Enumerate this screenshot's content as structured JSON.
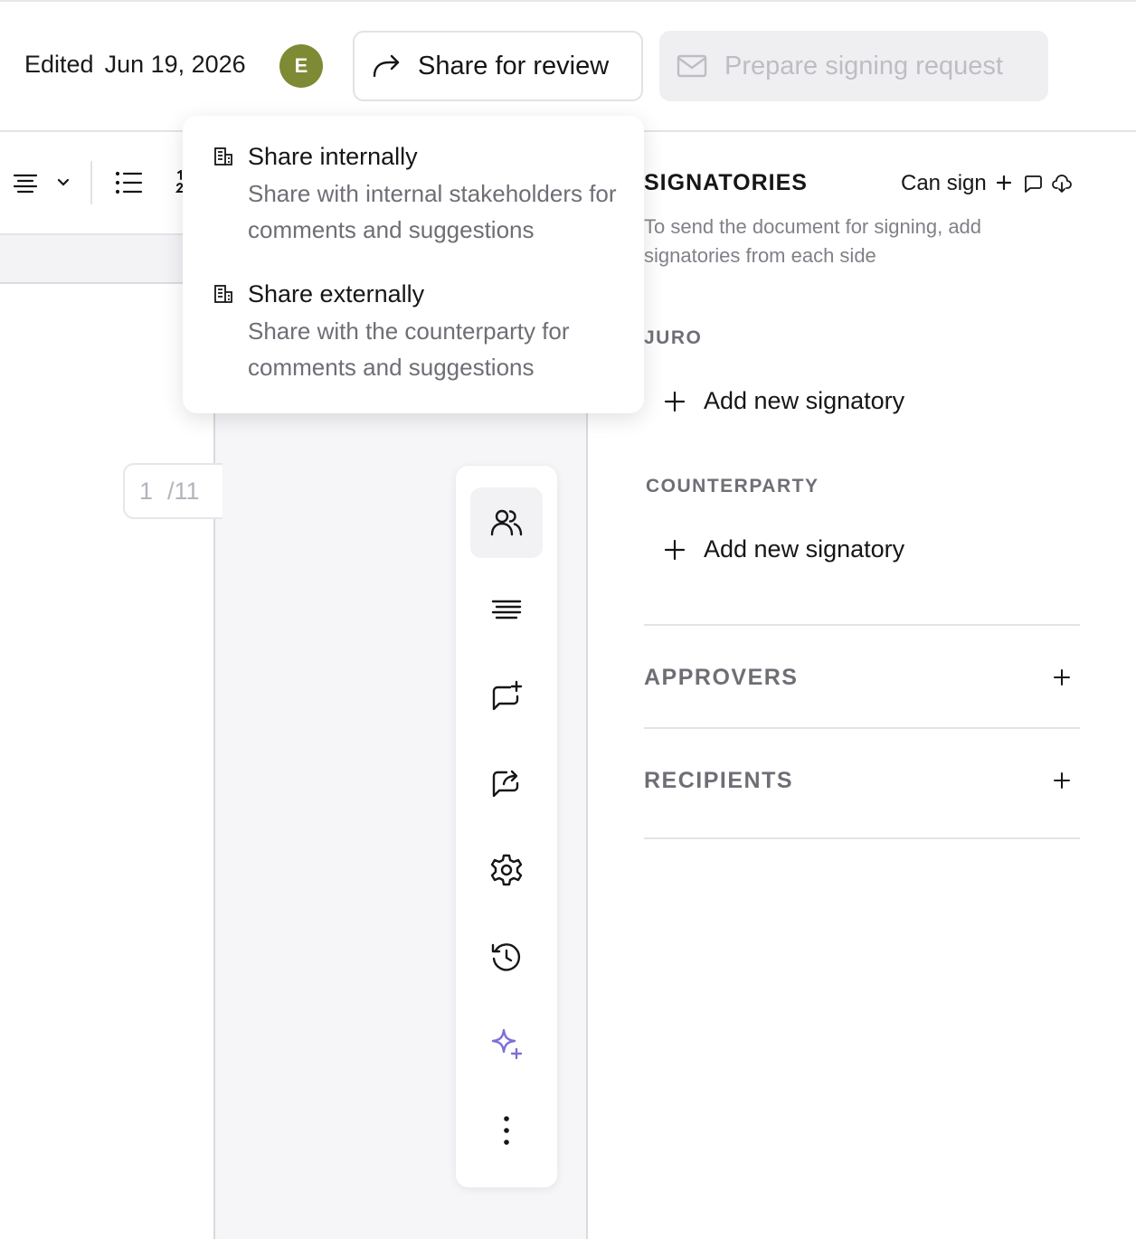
{
  "header": {
    "edited_label": "Edited",
    "edited_date": "Jun 19, 2026",
    "avatar_initial": "E",
    "avatar_color": "#7f8a35",
    "share_button_label": "Share for review",
    "prepare_button_label": "Prepare signing request"
  },
  "share_menu": {
    "items": [
      {
        "title": "Share internally",
        "description": "Share with internal stakeholders for comments and suggestions",
        "icon": "building-icon"
      },
      {
        "title": "Share externally",
        "description": "Share with the counterparty for comments and suggestions",
        "icon": "building-icon"
      }
    ]
  },
  "pager": {
    "current": "1",
    "total": "/11"
  },
  "rail": {
    "icons": [
      "users-icon",
      "align-icon",
      "comment-add-icon",
      "share-comment-icon",
      "settings-icon",
      "history-icon",
      "sparkle-icon",
      "more-vertical-icon"
    ],
    "active": "users-icon",
    "sparkle_color": "#7c6fd8"
  },
  "signatories": {
    "title": "SIGNATORIES",
    "role_label": "Can sign",
    "description": "To send the document for signing, add signatories from each side",
    "sections": [
      {
        "label": "JURO",
        "add_label": "Add new signatory"
      },
      {
        "label": "COUNTERPARTY",
        "add_label": "Add new signatory"
      }
    ]
  },
  "approvers": {
    "label": "APPROVERS"
  },
  "recipients": {
    "label": "RECIPIENTS"
  }
}
